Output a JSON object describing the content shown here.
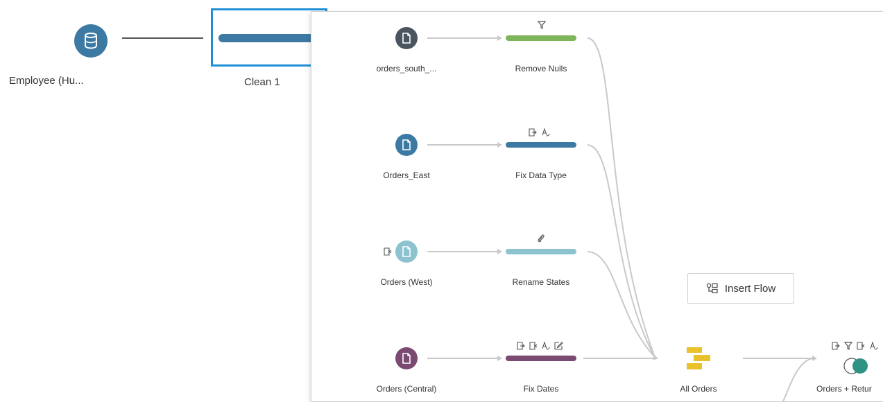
{
  "background_flow": {
    "input_label": "Employee (Hu...",
    "clean_label": "Clean 1",
    "colors": {
      "input": "#3d7aa3",
      "clean_bar": "#3d7aa3",
      "selected_border": "#1f8fd8",
      "connector": "#555555"
    }
  },
  "panel": {
    "rows": [
      {
        "input_label": "orders_south_...",
        "input_color": "#4a5560",
        "step_label": "Remove Nulls",
        "bar_color": "#7fb55a",
        "step_icons": [
          "filter-icon"
        ]
      },
      {
        "input_label": "Orders_East",
        "input_color": "#3d7aa3",
        "step_label": "Fix Data Type",
        "bar_color": "#3d7aa3",
        "step_icons": [
          "calc-field-icon",
          "rename-icon"
        ]
      },
      {
        "input_label": "Orders (West)",
        "input_color": "#8cc3cf",
        "step_label": "Rename States",
        "bar_color": "#8cc3cf",
        "step_icons": [
          "paperclip-icon"
        ],
        "input_badge": "remove-field-icon"
      },
      {
        "input_label": "Orders (Central)",
        "input_color": "#7a4a72",
        "step_label": "Fix Dates",
        "bar_color": "#7a4a72",
        "step_icons": [
          "calc-field-icon",
          "remove-field-icon",
          "rename-icon",
          "edit-icon"
        ]
      }
    ],
    "union": {
      "label": "All Orders",
      "color": "#e8c12b"
    },
    "join": {
      "label": "Orders + Retur",
      "color": "#2e9383",
      "step_icons": [
        "calc-field-icon",
        "filter-icon",
        "remove-field-icon",
        "rename-icon"
      ]
    },
    "insert_flow": {
      "label": "Insert Flow",
      "icon": "insert-flow-icon"
    }
  }
}
